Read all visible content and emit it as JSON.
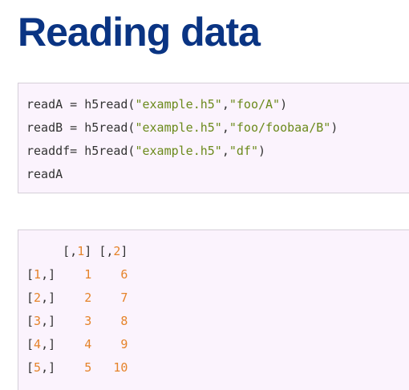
{
  "heading": {
    "title": "Reading data"
  },
  "input_code": {
    "lines": [
      {
        "plain1": "readA = h5read(",
        "str1": "\"example.h5\"",
        "plain2": ",",
        "str2": "\"foo/A\"",
        "plain3": ")"
      },
      {
        "plain1": "readB = h5read(",
        "str1": "\"example.h5\"",
        "plain2": ",",
        "str2": "\"foo/foobaa/B\"",
        "plain3": ")"
      },
      {
        "plain1": "readdf= h5read(",
        "str1": "\"example.h5\"",
        "plain2": ",",
        "str2": "\"df\"",
        "plain3": ")"
      },
      {
        "plain1": "readA"
      }
    ]
  },
  "output_matrix": {
    "col_headers": [
      {
        "open": "[,",
        "index": "1",
        "close": "]"
      },
      {
        "open": "[,",
        "index": "2",
        "close": "]"
      }
    ],
    "rows": [
      {
        "open": "[",
        "index": "1",
        "close": ",]",
        "v1": "1",
        "v2": "6"
      },
      {
        "open": "[",
        "index": "2",
        "close": ",]",
        "v1": "2",
        "v2": "7"
      },
      {
        "open": "[",
        "index": "3",
        "close": ",]",
        "v1": "3",
        "v2": "8"
      },
      {
        "open": "[",
        "index": "4",
        "close": ",]",
        "v1": "4",
        "v2": "9"
      },
      {
        "open": "[",
        "index": "5",
        "close": ",]",
        "v1": "5",
        "v2": "10"
      }
    ]
  },
  "colors": {
    "title": "#0a3483",
    "code_background": "#fbf3fd",
    "code_border": "#d5cfd8",
    "code_text": "#333333",
    "string_literal": "#6b8a1b",
    "number_literal": "#e5832a"
  }
}
